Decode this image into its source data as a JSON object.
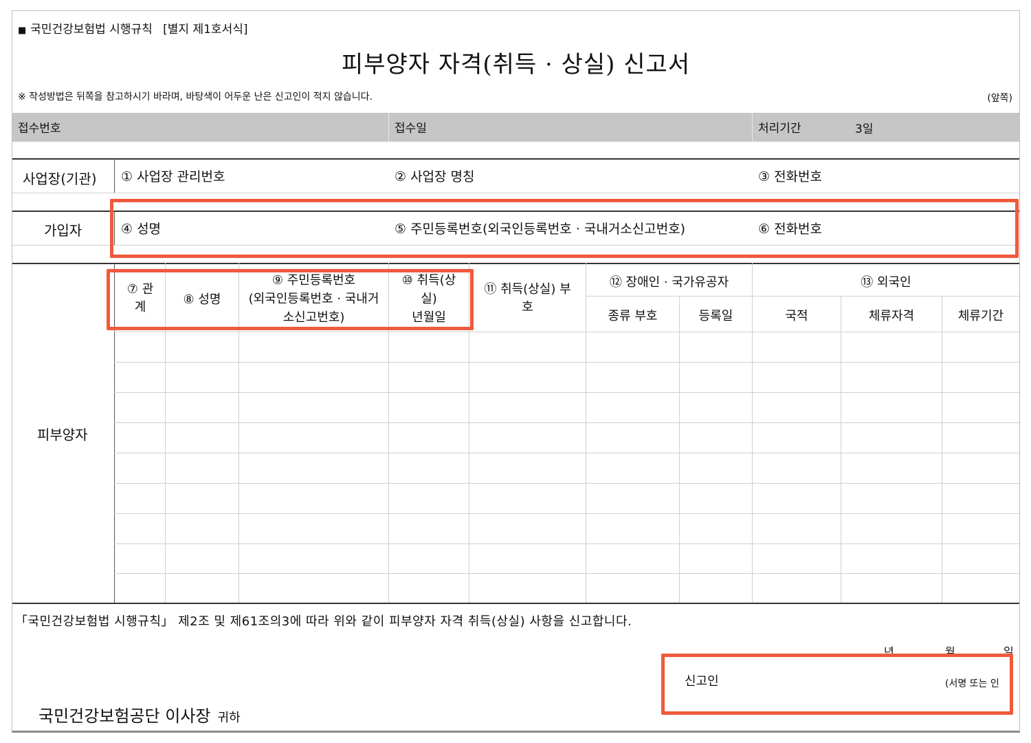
{
  "header": {
    "law_label": "국민건강보험법 시행규칙",
    "form_label": "[별지 제1호서식]",
    "title": "피부양자 자격(취득 · 상실) 신고서",
    "note": "※ 작성방법은 뒤쪽을 참고하시기 바라며, 바탕색이 어두운 난은 신고인이 적지 않습니다.",
    "side": "(앞쪽)"
  },
  "receipt": {
    "number_label": "접수번호",
    "date_label": "접수일",
    "period_label": "처리기간",
    "period_value": "3일"
  },
  "workplace": {
    "section_label": "사업장(기관)",
    "f1": "① 사업장 관리번호",
    "f2": "② 사업장 명칭",
    "f3": "③ 전화번호"
  },
  "subscriber": {
    "section_label": "가입자",
    "f4": "④ 성명",
    "f5": "⑤ 주민등록번호(외국인등록번호 · 국내거소신고번호)",
    "f6": "⑥ 전화번호"
  },
  "dependents": {
    "section_label": "피부양자",
    "c7a": "⑦ 관",
    "c7b": "계",
    "c8": "⑧ 성명",
    "c9a": "⑨ 주민등록번호",
    "c9b": "(외국인등록번호 · 국내거",
    "c9c": "소신고번호)",
    "c10a": "⑩ 취득(상",
    "c10b": "실)",
    "c10c": "년월일",
    "c11a": "⑪ 취득(상실) 부",
    "c11b": "호",
    "c12": "⑫ 장애인 · 국가유공자",
    "c12a": "종류 부호",
    "c12b": "등록일",
    "c13": "⑬ 외국인",
    "c13a": "국적",
    "c13b": "체류자격",
    "c13c": "체류기간"
  },
  "footer": {
    "statement": "「국민건강보험법 시행규칙」 제2조 및 제61조의3에 따라 위와 같이 피부양자 자격 취득(상실) 사항을 신고합니다.",
    "year": "년",
    "month": "월",
    "day": "일",
    "reporter_label": "신고인",
    "sign": "(서명 또는 인",
    "addressee": "국민건강보험공단 이사장",
    "honorific": "귀하"
  },
  "colors": {
    "highlight": "#f05a3c",
    "band": "#c6c6c6"
  }
}
